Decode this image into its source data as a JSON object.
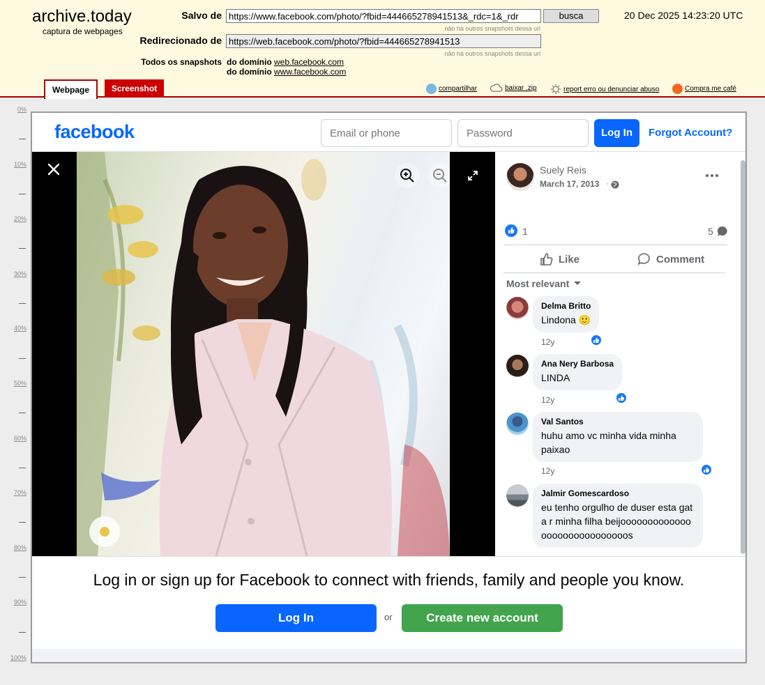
{
  "archive": {
    "logo": "archive.today",
    "logo_sub": "captura de webpages",
    "saved_label": "Salvo de",
    "saved_url": "https://www.facebook.com/photo/?fbid=444665278941513&_rdc=1&_rdr",
    "saved_note": "não há outros snapshots dessa url",
    "search_button": "busca",
    "timestamp": "20 Dec 2025 14:23:20 UTC",
    "redirect_label": "Redirecionado de",
    "redirect_url": "https://web.facebook.com/photo/?fbid=444665278941513",
    "redirect_note": "não há outros snapshots dessa url",
    "all_snapshots_label": "Todos os snapshots",
    "domain_prefix": "do domínio",
    "domain1": "web.facebook.com",
    "domain2": "www.facebook.com",
    "tabs": [
      "Webpage",
      "Screenshot"
    ],
    "links": {
      "share": "compartilhar",
      "download": "baixar .zip",
      "report": "report erro ou denunciar abuso",
      "donate": "Compra me café"
    },
    "ruler": [
      "0%",
      "10%",
      "20%",
      "30%",
      "40%",
      "50%",
      "60%",
      "70%",
      "80%",
      "90%",
      "100%"
    ],
    "colors": {
      "header_bg": "#fff9e0",
      "tab_red": "#cc0000"
    }
  },
  "facebook": {
    "logo": "facebook",
    "email_placeholder": "Email or phone",
    "password_placeholder": "Password",
    "login_button": "Log In",
    "forgot": "Forgot Account?",
    "post": {
      "author": "Suely Reis",
      "date": "March 17, 2013",
      "reaction_count": "1",
      "comment_count": "5",
      "like_label": "Like",
      "comment_label": "Comment",
      "sort_label": "Most relevant"
    },
    "comments": [
      {
        "name": "Delma Britto",
        "text": "Lindona 🙂",
        "time": "12y"
      },
      {
        "name": "Ana Nery Barbosa",
        "text": "LINDA",
        "time": "12y"
      },
      {
        "name": "Val Santos",
        "text": "huhu amo vc minha vida minha paixao",
        "time": "12y"
      },
      {
        "name": "Jalmir Gomescardoso",
        "text": "eu tenho orgulho de duser esta gata r minha filha beijooooooooooooooooooooooooooooos",
        "time": ""
      }
    ],
    "banner": {
      "text": "Log in or sign up for Facebook to connect with friends, family and people you know.",
      "login": "Log In",
      "or": "or",
      "create": "Create new account"
    },
    "colors": {
      "brand": "#0866ff",
      "create_green": "#42a54d"
    }
  }
}
